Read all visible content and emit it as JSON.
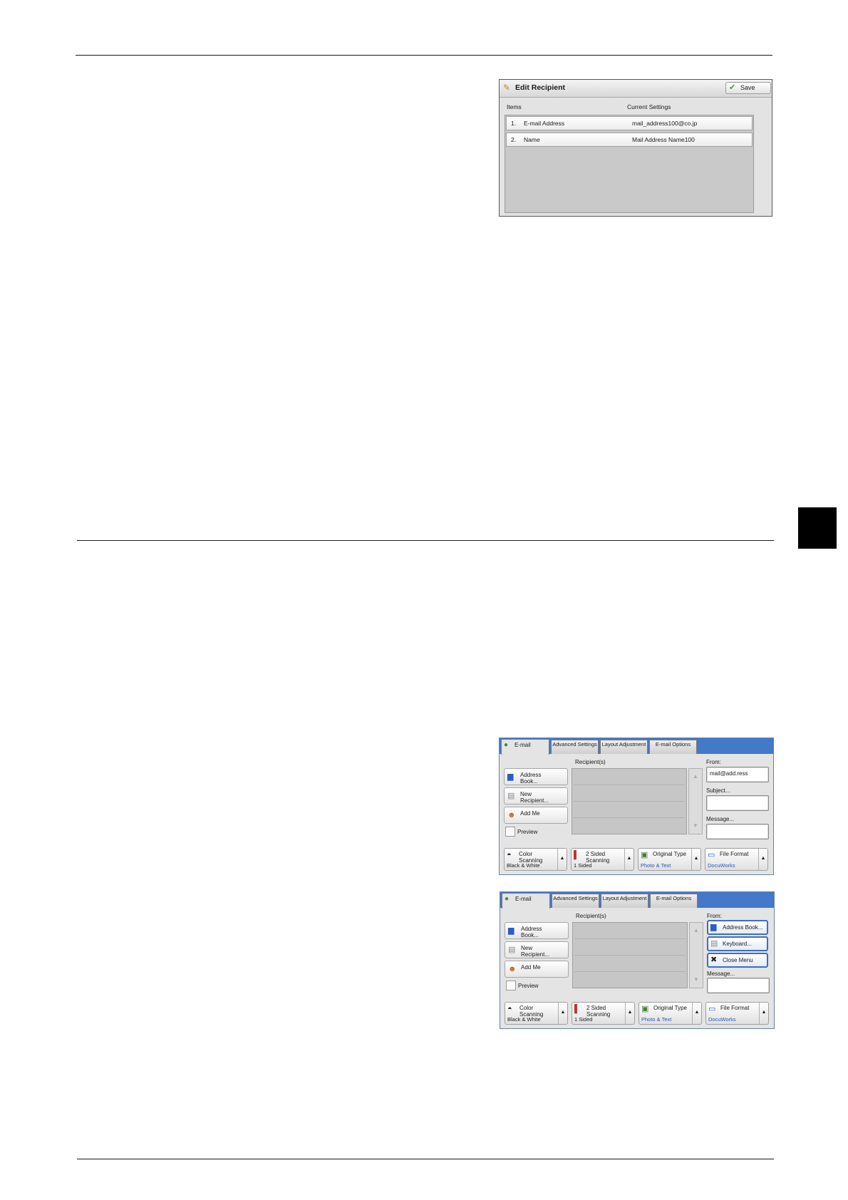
{
  "edit_recipient": {
    "title": "Edit Recipient",
    "title_icon": "wrench-icon",
    "save_label": "Save",
    "save_icon": "check-icon",
    "col_items": "Items",
    "col_current": "Current Settings",
    "rows": [
      {
        "num": "1.",
        "item": "E-mail Address",
        "value": "mail_address100@co.jp"
      },
      {
        "num": "2.",
        "item": "Name",
        "value": "Mail Address Name100"
      }
    ]
  },
  "email_screen_1": {
    "tabs": [
      "E-mail",
      "Advanced Settings",
      "Layout Adjustment",
      "E-mail Options"
    ],
    "recipients_label": "Recipient(s)",
    "address_book": "Address Book...",
    "new_recipient": "New Recipient...",
    "add_me": "Add Me",
    "preview": "Preview",
    "from_label": "From:",
    "from_value": "mail@add.ress",
    "subject_label": "Subject...",
    "message_label": "Message...",
    "bottom": [
      {
        "label": "Color Scanning",
        "value": "Black & White"
      },
      {
        "label": "2 Sided Scanning",
        "value": "1 Sided"
      },
      {
        "label": "Original Type",
        "value": "Photo & Text"
      },
      {
        "label": "File Format",
        "value": "DocuWorks"
      }
    ]
  },
  "email_screen_2": {
    "tabs": [
      "E-mail",
      "Advanced Settings",
      "Layout Adjustment",
      "E-mail Options"
    ],
    "recipients_label": "Recipient(s)",
    "address_book": "Address Book...",
    "new_recipient": "New Recipient...",
    "add_me": "Add Me",
    "preview": "Preview",
    "from_label": "From:",
    "menu": [
      "Address Book...",
      "Keyboard...",
      "Close Menu"
    ],
    "message_label": "Message...",
    "bottom": [
      {
        "label": "Color Scanning",
        "value": "Black & White"
      },
      {
        "label": "2 Sided Scanning",
        "value": "1 Sided"
      },
      {
        "label": "Original Type",
        "value": "Photo & Text"
      },
      {
        "label": "File Format",
        "value": "DocuWorks"
      }
    ]
  }
}
